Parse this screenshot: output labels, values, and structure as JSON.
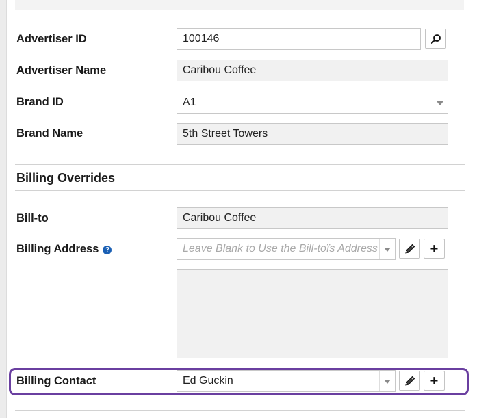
{
  "advertiser": {
    "id_label": "Advertiser ID",
    "id_value": "100146",
    "name_label": "Advertiser Name",
    "name_value": "Caribou Coffee"
  },
  "brand": {
    "id_label": "Brand ID",
    "id_value": "A1",
    "name_label": "Brand Name",
    "name_value": "5th Street Towers"
  },
  "billing": {
    "section_title": "Billing Overrides",
    "bill_to_label": "Bill-to",
    "bill_to_value": "Caribou Coffee",
    "address_label": "Billing Address",
    "address_placeholder": "Leave Blank to Use the Bill-toïs Address",
    "help_glyph": "?",
    "contact_label": "Billing Contact",
    "contact_value": "Ed Guckin",
    "add_glyph": "+"
  },
  "icons": {
    "search": "search-icon",
    "edit": "pencil-icon",
    "add": "plus-icon",
    "help": "question-circle-icon",
    "dropdown": "chevron-down-icon"
  },
  "colors": {
    "highlight_border": "#6a3fa0",
    "help_icon": "#1a5fb4",
    "readonly_field_bg": "#f1f1f1"
  }
}
